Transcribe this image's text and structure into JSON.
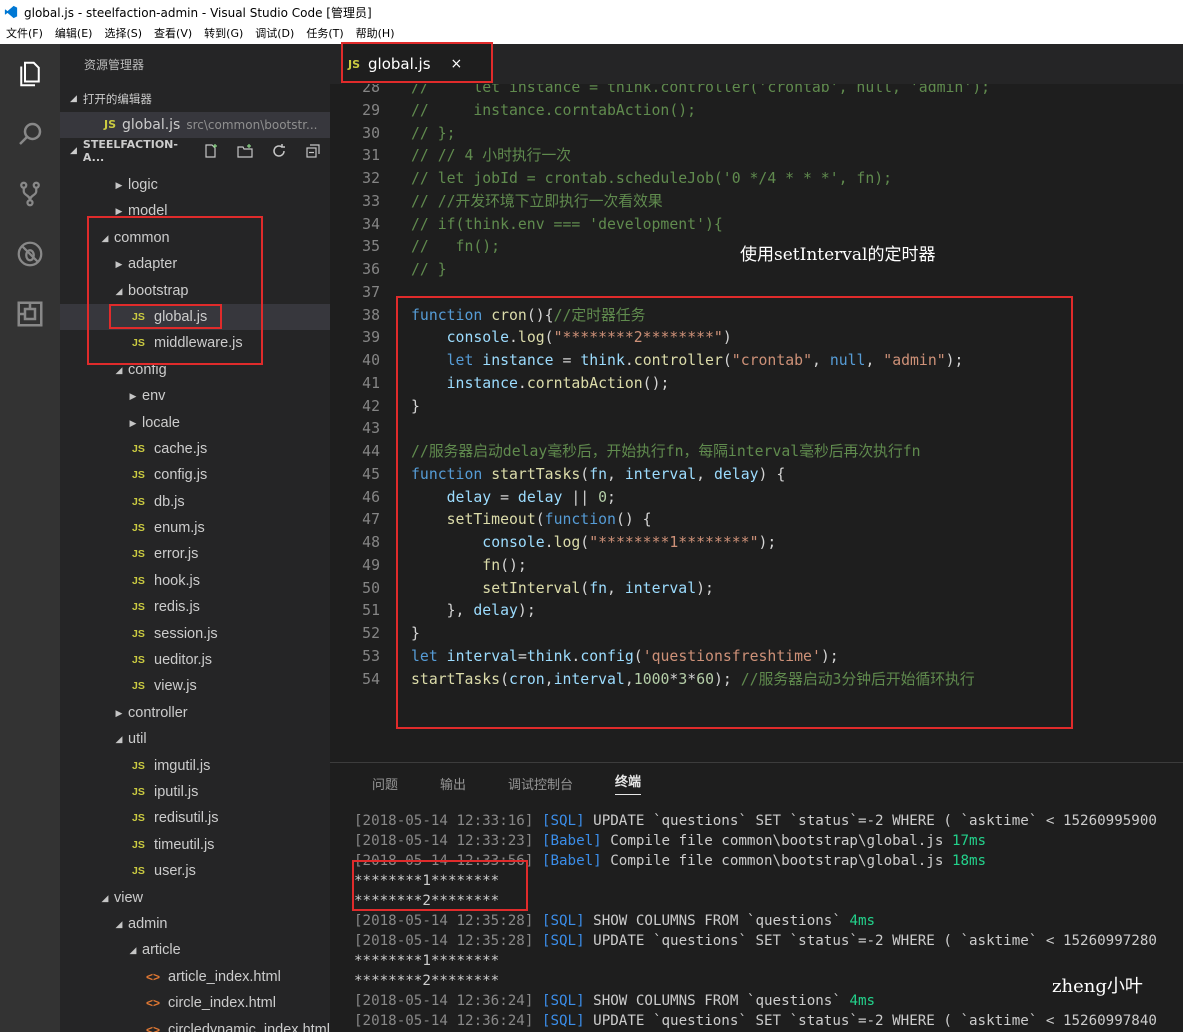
{
  "window": {
    "title": "global.js - steelfaction-admin - Visual Studio Code [管理员]"
  },
  "menu": [
    "文件(F)",
    "编辑(E)",
    "选择(S)",
    "查看(V)",
    "转到(G)",
    "调试(D)",
    "任务(T)",
    "帮助(H)"
  ],
  "activity_bar": [
    "explorer-icon",
    "search-icon",
    "source-control-icon",
    "debug-icon",
    "extensions-icon"
  ],
  "sidebar": {
    "title": "资源管理器",
    "open_editors_label": "打开的编辑器",
    "open_editor": {
      "name": "global.js",
      "path": "src\\common\\bootstr..."
    },
    "project_label": "STEELFACTION-A...",
    "tree": [
      {
        "label": "logic",
        "kind": "folder-closed",
        "depth": 1
      },
      {
        "label": "model",
        "kind": "folder-closed",
        "depth": 1
      },
      {
        "label": "common",
        "kind": "folder-open",
        "depth": 0
      },
      {
        "label": "adapter",
        "kind": "folder-closed",
        "depth": 1
      },
      {
        "label": "bootstrap",
        "kind": "folder-open",
        "depth": 1
      },
      {
        "label": "global.js",
        "kind": "js",
        "depth": 2,
        "selected": true
      },
      {
        "label": "middleware.js",
        "kind": "js",
        "depth": 2
      },
      {
        "label": "config",
        "kind": "folder-open",
        "depth": 1
      },
      {
        "label": "env",
        "kind": "folder-closed",
        "depth": 2
      },
      {
        "label": "locale",
        "kind": "folder-closed",
        "depth": 2
      },
      {
        "label": "cache.js",
        "kind": "js",
        "depth": 2
      },
      {
        "label": "config.js",
        "kind": "js",
        "depth": 2
      },
      {
        "label": "db.js",
        "kind": "js",
        "depth": 2
      },
      {
        "label": "enum.js",
        "kind": "js",
        "depth": 2
      },
      {
        "label": "error.js",
        "kind": "js",
        "depth": 2
      },
      {
        "label": "hook.js",
        "kind": "js",
        "depth": 2
      },
      {
        "label": "redis.js",
        "kind": "js",
        "depth": 2
      },
      {
        "label": "session.js",
        "kind": "js",
        "depth": 2
      },
      {
        "label": "ueditor.js",
        "kind": "js",
        "depth": 2
      },
      {
        "label": "view.js",
        "kind": "js",
        "depth": 2
      },
      {
        "label": "controller",
        "kind": "folder-closed",
        "depth": 1
      },
      {
        "label": "util",
        "kind": "folder-open",
        "depth": 1
      },
      {
        "label": "imgutil.js",
        "kind": "js",
        "depth": 2
      },
      {
        "label": "iputil.js",
        "kind": "js",
        "depth": 2
      },
      {
        "label": "redisutil.js",
        "kind": "js",
        "depth": 2
      },
      {
        "label": "timeutil.js",
        "kind": "js",
        "depth": 2
      },
      {
        "label": "user.js",
        "kind": "js",
        "depth": 2
      },
      {
        "label": "view",
        "kind": "folder-open",
        "depth": 0
      },
      {
        "label": "admin",
        "kind": "folder-open",
        "depth": 1
      },
      {
        "label": "article",
        "kind": "folder-open",
        "depth": 2
      },
      {
        "label": "article_index.html",
        "kind": "html",
        "depth": 3
      },
      {
        "label": "circle_index.html",
        "kind": "html",
        "depth": 3
      },
      {
        "label": "circledynamic_index.html",
        "kind": "html",
        "depth": 3
      }
    ]
  },
  "editor": {
    "tab": {
      "label": "global.js",
      "badge": "JS",
      "close": "×"
    },
    "annotation": "使用setInterval的定时器",
    "lines": [
      {
        "n": "28",
        "tokens": [
          [
            "c",
            "//     let instance = think.controller('crontab', null, 'admin');"
          ]
        ]
      },
      {
        "n": "29",
        "tokens": [
          [
            "c",
            "//     instance.corntabAction();"
          ]
        ]
      },
      {
        "n": "30",
        "tokens": [
          [
            "c",
            "// };"
          ]
        ]
      },
      {
        "n": "31",
        "tokens": [
          [
            "c",
            "// // 4 小时执行一次"
          ]
        ]
      },
      {
        "n": "32",
        "tokens": [
          [
            "c",
            "// let jobId = crontab.scheduleJob('0 */4 * * *', fn);"
          ]
        ]
      },
      {
        "n": "33",
        "tokens": [
          [
            "c",
            "// //开发环境下立即执行一次看效果"
          ]
        ]
      },
      {
        "n": "34",
        "tokens": [
          [
            "c",
            "// if(think.env === 'development'){"
          ]
        ]
      },
      {
        "n": "35",
        "tokens": [
          [
            "c",
            "//   fn();"
          ]
        ]
      },
      {
        "n": "36",
        "tokens": [
          [
            "c",
            "// }"
          ]
        ]
      },
      {
        "n": "37",
        "tokens": []
      },
      {
        "n": "38",
        "tokens": [
          [
            "k",
            "function"
          ],
          [
            "p",
            " "
          ],
          [
            "f",
            "cron"
          ],
          [
            "p",
            "(){"
          ],
          [
            "c",
            "//定时器任务"
          ]
        ]
      },
      {
        "n": "39",
        "tokens": [
          [
            "p",
            "    "
          ],
          [
            "v",
            "console"
          ],
          [
            "p",
            "."
          ],
          [
            "f",
            "log"
          ],
          [
            "p",
            "("
          ],
          [
            "s",
            "\"********2********\""
          ],
          [
            "p",
            ")"
          ]
        ]
      },
      {
        "n": "40",
        "tokens": [
          [
            "p",
            "    "
          ],
          [
            "k",
            "let"
          ],
          [
            "p",
            " "
          ],
          [
            "v",
            "instance"
          ],
          [
            "p",
            " = "
          ],
          [
            "v",
            "think"
          ],
          [
            "p",
            "."
          ],
          [
            "f",
            "controller"
          ],
          [
            "p",
            "("
          ],
          [
            "s",
            "\"crontab\""
          ],
          [
            "p",
            ", "
          ],
          [
            "k",
            "null"
          ],
          [
            "p",
            ", "
          ],
          [
            "s",
            "\"admin\""
          ],
          [
            "p",
            ");"
          ]
        ]
      },
      {
        "n": "41",
        "tokens": [
          [
            "p",
            "    "
          ],
          [
            "v",
            "instance"
          ],
          [
            "p",
            "."
          ],
          [
            "f",
            "corntabAction"
          ],
          [
            "p",
            "();"
          ]
        ]
      },
      {
        "n": "42",
        "tokens": [
          [
            "p",
            "}"
          ]
        ]
      },
      {
        "n": "43",
        "tokens": []
      },
      {
        "n": "44",
        "tokens": [
          [
            "c",
            "//服务器启动delay毫秒后，开始执行fn，每隔interval毫秒后再次执行fn"
          ]
        ]
      },
      {
        "n": "45",
        "tokens": [
          [
            "k",
            "function"
          ],
          [
            "p",
            " "
          ],
          [
            "f",
            "startTasks"
          ],
          [
            "p",
            "("
          ],
          [
            "v",
            "fn"
          ],
          [
            "p",
            ", "
          ],
          [
            "v",
            "interval"
          ],
          [
            "p",
            ", "
          ],
          [
            "v",
            "delay"
          ],
          [
            "p",
            ") {"
          ]
        ]
      },
      {
        "n": "46",
        "tokens": [
          [
            "p",
            "    "
          ],
          [
            "v",
            "delay"
          ],
          [
            "p",
            " = "
          ],
          [
            "v",
            "delay"
          ],
          [
            "p",
            " || "
          ],
          [
            "n",
            "0"
          ],
          [
            "p",
            ";"
          ]
        ]
      },
      {
        "n": "47",
        "tokens": [
          [
            "p",
            "    "
          ],
          [
            "f",
            "setTimeout"
          ],
          [
            "p",
            "("
          ],
          [
            "k",
            "function"
          ],
          [
            "p",
            "() {"
          ]
        ]
      },
      {
        "n": "48",
        "tokens": [
          [
            "p",
            "        "
          ],
          [
            "v",
            "console"
          ],
          [
            "p",
            "."
          ],
          [
            "f",
            "log"
          ],
          [
            "p",
            "("
          ],
          [
            "s",
            "\"********1********\""
          ],
          [
            "p",
            ");"
          ]
        ]
      },
      {
        "n": "49",
        "tokens": [
          [
            "p",
            "        "
          ],
          [
            "f",
            "fn"
          ],
          [
            "p",
            "();"
          ]
        ]
      },
      {
        "n": "50",
        "tokens": [
          [
            "p",
            "        "
          ],
          [
            "f",
            "setInterval"
          ],
          [
            "p",
            "("
          ],
          [
            "v",
            "fn"
          ],
          [
            "p",
            ", "
          ],
          [
            "v",
            "interval"
          ],
          [
            "p",
            ");"
          ]
        ]
      },
      {
        "n": "51",
        "tokens": [
          [
            "p",
            "    }, "
          ],
          [
            "v",
            "delay"
          ],
          [
            "p",
            ");"
          ]
        ]
      },
      {
        "n": "52",
        "tokens": [
          [
            "p",
            "}"
          ]
        ]
      },
      {
        "n": "53",
        "tokens": [
          [
            "k",
            "let"
          ],
          [
            "p",
            " "
          ],
          [
            "v",
            "interval"
          ],
          [
            "p",
            "="
          ],
          [
            "v",
            "think"
          ],
          [
            "p",
            "."
          ],
          [
            "v",
            "config"
          ],
          [
            "p",
            "("
          ],
          [
            "s",
            "'questionsfreshtime'"
          ],
          [
            "p",
            ");"
          ]
        ]
      },
      {
        "n": "54",
        "tokens": [
          [
            "f",
            "startTasks"
          ],
          [
            "p",
            "("
          ],
          [
            "v",
            "cron"
          ],
          [
            "p",
            ","
          ],
          [
            "v",
            "interval"
          ],
          [
            "p",
            ","
          ],
          [
            "n",
            "1000"
          ],
          [
            "p",
            "*"
          ],
          [
            "n",
            "3"
          ],
          [
            "p",
            "*"
          ],
          [
            "n",
            "60"
          ],
          [
            "p",
            "); "
          ],
          [
            "c",
            "//服务器启动3分钟后开始循环执行"
          ]
        ]
      }
    ]
  },
  "panel": {
    "tabs": [
      "问题",
      "输出",
      "调试控制台",
      "终端"
    ],
    "active_tab": "终端",
    "lines": [
      {
        "ts": "[2018-05-14 12:33:16]",
        "tag": "[SQL]",
        "text": " UPDATE `questions` SET `status`=-2 WHERE ( `asktime` < 15260995900",
        "ms": ""
      },
      {
        "ts": "[2018-05-14 12:33:23]",
        "tag": "[Babel]",
        "text": " Compile file common\\bootstrap\\global.js ",
        "ms": "17ms"
      },
      {
        "ts": "[2018-05-14 12:33:56]",
        "tag": "[Babel]",
        "text": " Compile file common\\bootstrap\\global.js ",
        "ms": "18ms"
      },
      {
        "ts": "",
        "tag": "",
        "text": "********1********",
        "ms": ""
      },
      {
        "ts": "",
        "tag": "",
        "text": "********2********",
        "ms": ""
      },
      {
        "ts": "[2018-05-14 12:35:28]",
        "tag": "[SQL]",
        "text": " SHOW COLUMNS FROM `questions` ",
        "ms": "4ms"
      },
      {
        "ts": "[2018-05-14 12:35:28]",
        "tag": "[SQL]",
        "text": " UPDATE `questions` SET `status`=-2 WHERE ( `asktime` < 15260997280",
        "ms": ""
      },
      {
        "ts": "",
        "tag": "",
        "text": "********1********",
        "ms": ""
      },
      {
        "ts": "",
        "tag": "",
        "text": "********2********",
        "ms": ""
      },
      {
        "ts": "[2018-05-14 12:36:24]",
        "tag": "[SQL]",
        "text": " SHOW COLUMNS FROM `questions` ",
        "ms": "4ms"
      },
      {
        "ts": "[2018-05-14 12:36:24]",
        "tag": "[SQL]",
        "text": " UPDATE `questions` SET `status`=-2 WHERE ( `asktime` < 15260997840",
        "ms": ""
      }
    ]
  },
  "watermark": "zheng小叶"
}
